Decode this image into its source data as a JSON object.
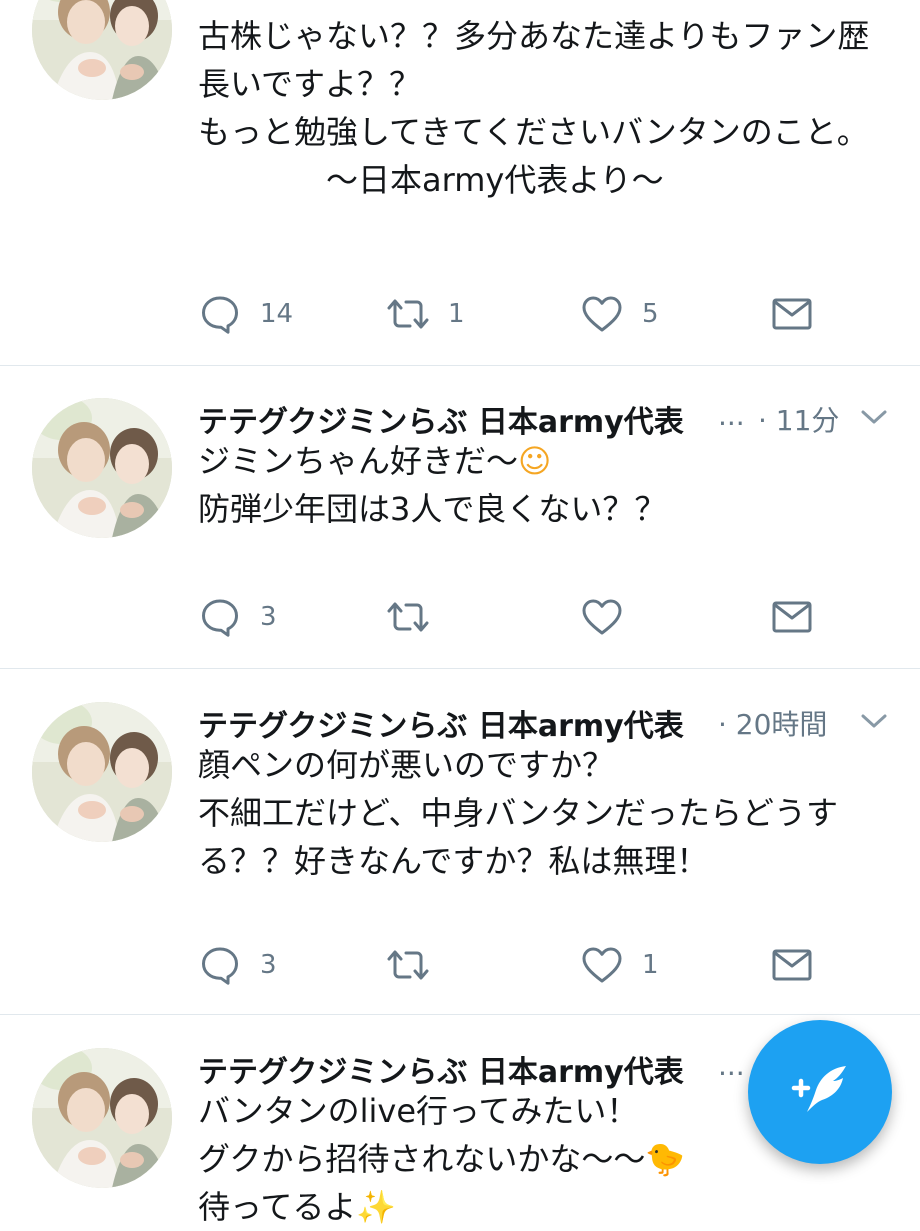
{
  "tweets": [
    {
      "lines": [
        "古株じゃない？？多分あなた達よりもファン歴",
        "長いですよ？？",
        "",
        "もっと勉強してきてくださいバンタンのこと。",
        "",
        "　　〜日本army代表より〜"
      ],
      "reply_count": "14",
      "retweet_count": "1",
      "like_count": "5"
    },
    {
      "author": "テテグクジミンらぶ 日本army代表",
      "ellipsis": "...",
      "time": "· 11分",
      "lines": [
        "ジミンちゃん好きだ〜",
        "",
        "防弾少年団は3人で良くない？？"
      ],
      "emoji": "☺",
      "reply_count": "3",
      "retweet_count": "",
      "like_count": ""
    },
    {
      "author": "テテグクジミンらぶ 日本army代表",
      "time": "· 20時間",
      "lines": [
        "顔ペンの何が悪いのですか？",
        "",
        "不細工だけど、中身バンタンだったらどうす",
        "る？？好きなんですか？私は無理！"
      ],
      "reply_count": "3",
      "retweet_count": "",
      "like_count": "1"
    },
    {
      "author": "テテグクジミンらぶ 日本army代表",
      "ellipsis": "...",
      "lines": [
        "バンタンのlive行ってみたい！",
        "グクから招待されないかな〜〜",
        "待ってるよ"
      ],
      "emoji_chick": "🐤",
      "emoji_sparkle": "✨"
    }
  ],
  "icons": {
    "reply": "reply-icon",
    "retweet": "retweet-icon",
    "like": "heart-icon",
    "dm": "envelope-icon",
    "compose": "compose-tweet-icon"
  },
  "colors": {
    "accent": "#1da1f2",
    "icon": "#657786",
    "text": "#14171a",
    "divider": "#e1e8ed"
  }
}
